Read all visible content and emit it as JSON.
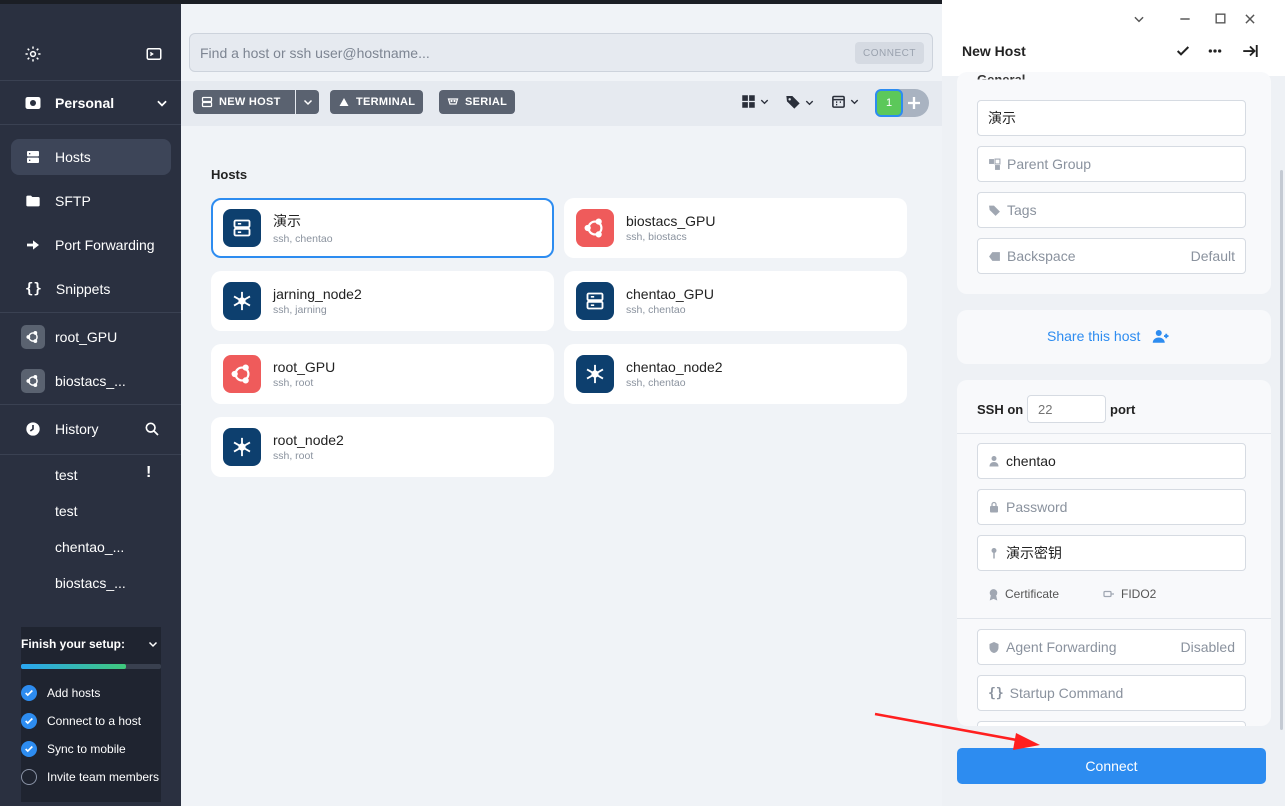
{
  "sidebar": {
    "workspace": "Personal",
    "nav": [
      {
        "label": "Hosts",
        "icon": "server-icon"
      },
      {
        "label": "SFTP",
        "icon": "folder-icon"
      },
      {
        "label": "Port Forwarding",
        "icon": "port-forward-icon"
      },
      {
        "label": "Snippets",
        "icon": "braces-icon"
      }
    ],
    "recent": [
      {
        "label": "root_GPU",
        "icon": "ubuntu-icon"
      },
      {
        "label": "biostacs_...",
        "icon": "ubuntu-icon"
      }
    ],
    "history_label": "History",
    "history": [
      {
        "label": "test",
        "warning": "!"
      },
      {
        "label": "test"
      },
      {
        "label": "chentao_..."
      },
      {
        "label": "biostacs_..."
      }
    ],
    "setup": {
      "title": "Finish your setup:",
      "progress": 0.75,
      "tasks": [
        {
          "label": "Add hosts",
          "done": true
        },
        {
          "label": "Connect to a host",
          "done": true
        },
        {
          "label": "Sync to mobile",
          "done": true
        },
        {
          "label": "Invite team members",
          "done": false
        }
      ]
    }
  },
  "search": {
    "placeholder": "Find a host or ssh user@hostname...",
    "connect_label": "CONNECT"
  },
  "toolbar": {
    "new_host": "NEW HOST",
    "terminal": "TERMINAL",
    "serial": "SERIAL",
    "badge_count": "1"
  },
  "hosts": {
    "title": "Hosts",
    "items": [
      {
        "name": "演示",
        "sub": "ssh, chentao",
        "icon": "server-icon",
        "color": "#0d3f6e",
        "selected": true
      },
      {
        "name": "biostacs_GPU",
        "sub": "ssh, biostacs",
        "icon": "ubuntu-icon",
        "color": "#ef5b5b"
      },
      {
        "name": "jarning_node2",
        "sub": "ssh, jarning",
        "icon": "snowflake-icon",
        "color": "#0d3f6e"
      },
      {
        "name": "chentao_GPU",
        "sub": "ssh, chentao",
        "icon": "server-icon",
        "color": "#0d3f6e"
      },
      {
        "name": "root_GPU",
        "sub": "ssh, root",
        "icon": "ubuntu-icon",
        "color": "#ef5b5b"
      },
      {
        "name": "chentao_node2",
        "sub": "ssh, chentao",
        "icon": "snowflake-icon",
        "color": "#0d3f6e"
      },
      {
        "name": "root_node2",
        "sub": "ssh, root",
        "icon": "snowflake-icon",
        "color": "#0d3f6e"
      }
    ]
  },
  "panel": {
    "title": "New Host",
    "section_general": "General",
    "label_value": "演示",
    "parent_group": "Parent Group",
    "tags": "Tags",
    "backspace": "Backspace",
    "backspace_value": "Default",
    "share": "Share this host",
    "ssh_on": "SSH on",
    "port_placeholder": "22",
    "port_label": "port",
    "username": "chentao",
    "password_placeholder": "Password",
    "key": "演示密钥",
    "certificate": "Certificate",
    "fido2": "FIDO2",
    "agent_forwarding": "Agent Forwarding",
    "agent_forwarding_value": "Disabled",
    "startup_command": "Startup Command",
    "connect": "Connect"
  }
}
